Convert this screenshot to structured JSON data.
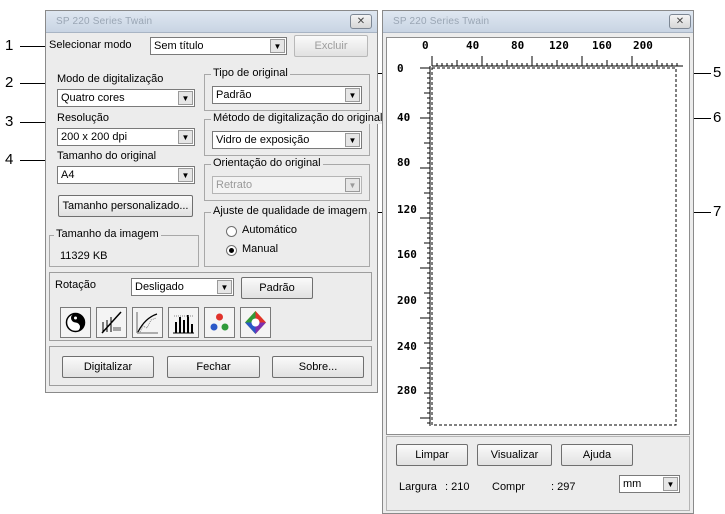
{
  "callouts": [
    "1",
    "2",
    "3",
    "4",
    "5",
    "6",
    "7"
  ],
  "left_window": {
    "title": "SP 220 Series Twain",
    "close_symbol": "✕",
    "select_mode_label": "Selecionar modo",
    "select_mode_value": "Sem título",
    "delete_button": "Excluir",
    "scan_mode_label": "Modo de digitalização",
    "scan_mode_value": "Quatro cores",
    "resolution_label": "Resolução",
    "resolution_value": "200 x 200 dpi",
    "original_size_label": "Tamanho do original",
    "original_size_value": "A4",
    "custom_size_button": "Tamanho personalizado...",
    "image_size_label": "Tamanho da imagem",
    "image_size_value": "11329 KB",
    "original_type_label": "Tipo de original",
    "original_type_value": "Padrão",
    "scan_method_label": "Método de digitalização do original",
    "scan_method_value": "Vidro de exposição",
    "orientation_label": "Orientação do original",
    "orientation_value": "Retrato",
    "quality_label": "Ajuste de qualidade de imagem",
    "quality_options": [
      "Automático",
      "Manual"
    ],
    "quality_selected": "Manual",
    "rotation_label": "Rotação",
    "rotation_value": "Desligado",
    "default_button": "Padrão",
    "scan_button": "Digitalizar",
    "close_button": "Fechar",
    "about_button": "Sobre..."
  },
  "right_window": {
    "title": "SP 220 Series Twain",
    "close_symbol": "✕",
    "ruler_top": [
      "0",
      "40",
      "80",
      "120",
      "160",
      "200"
    ],
    "ruler_left": [
      "0",
      "40",
      "80",
      "120",
      "160",
      "200",
      "240",
      "280"
    ],
    "clear_button": "Limpar",
    "preview_button": "Visualizar",
    "help_button": "Ajuda",
    "width_label": "Largura",
    "width_value": ": 210",
    "length_label": "Compr",
    "length_value": ": 297",
    "unit_value": "mm"
  },
  "icons": [
    "brightness-contrast-icon",
    "threshold-icon",
    "tone-curve-icon",
    "histogram-icon",
    "color-balance-icon",
    "hue-saturation-icon"
  ]
}
